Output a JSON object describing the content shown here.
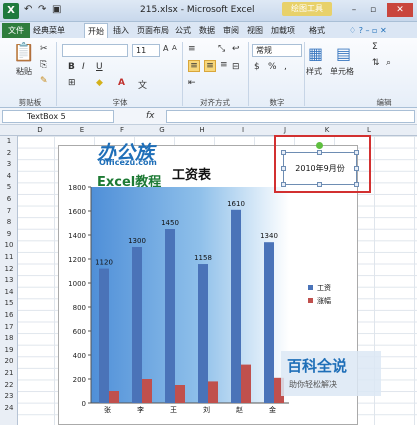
{
  "window": {
    "title": "215.xlsx - Microsoft Excel",
    "context_tab": "绘图工具",
    "app_logo": "X"
  },
  "quick_access": {
    "save_icon": "save-icon",
    "undo_icon": "undo-icon",
    "redo_icon": "redo-icon"
  },
  "tabs": [
    "文件",
    "经典菜单",
    "开始",
    "插入",
    "页面布局",
    "公式",
    "数据",
    "审阅",
    "视图",
    "加载项",
    "格式"
  ],
  "ribbon": {
    "paste_label": "粘贴",
    "clipboard_label": "剪贴板",
    "font_label": "字体",
    "font_size": "11",
    "align_label": "对齐方式",
    "number_label": "数字",
    "number_format": "常规",
    "styles_label": "样式",
    "cells_label": "单元格",
    "edit_label": "编辑"
  },
  "formula_bar": {
    "name_box": "TextBox 5",
    "fx": "fx"
  },
  "columns": [
    "D",
    "E",
    "F",
    "G",
    "H",
    "I",
    "J",
    "K",
    "L"
  ],
  "rows": [
    "1",
    "2",
    "3",
    "4",
    "5",
    "6",
    "7",
    "8",
    "9",
    "10",
    "11",
    "12",
    "13",
    "14",
    "15",
    "16",
    "17",
    "18",
    "19",
    "20",
    "21",
    "22",
    "23",
    "24"
  ],
  "watermark": {
    "brand": "办公族",
    "site": "Officezu.com",
    "course": "Excel教程"
  },
  "textbox": {
    "text": "2010年9月份"
  },
  "baidu": {
    "title": "百科全说",
    "subtitle": "助你轻松解决"
  },
  "colors": {
    "salary": "#4a73b8",
    "raise": "#c0504d",
    "accent_red": "#d23030"
  },
  "chart_data": {
    "type": "bar",
    "title": "工资表",
    "categories": [
      "张",
      "李",
      "王",
      "刘",
      "赵",
      "金"
    ],
    "series": [
      {
        "name": "工资",
        "values": [
          1120,
          1300,
          1450,
          1158,
          1610,
          1340
        ]
      },
      {
        "name": "涨幅",
        "values": [
          100,
          200,
          150,
          180,
          320,
          210
        ]
      }
    ],
    "ylim": [
      0,
      1800
    ],
    "yticks": [
      "1800",
      "1600",
      "1400",
      "1200",
      "1000",
      "800",
      "600",
      "400",
      "200",
      "0"
    ],
    "data_labels": [
      "1120",
      "1300",
      "1450",
      "1158",
      "1610",
      "1340"
    ],
    "legend_position": "right"
  }
}
